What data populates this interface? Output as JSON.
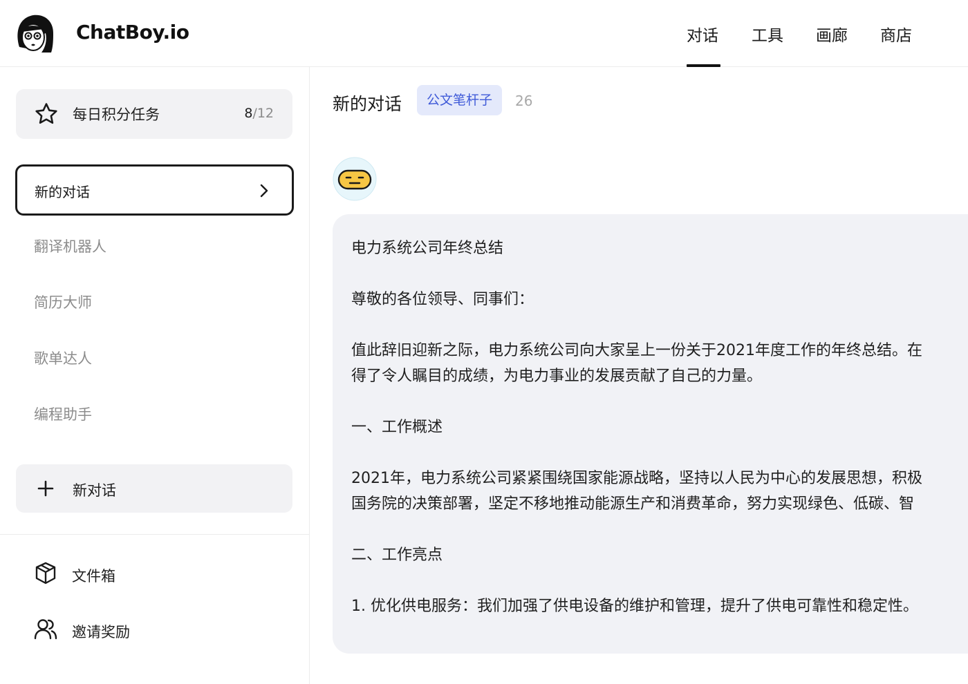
{
  "header": {
    "brand": "ChatBoy.io",
    "nav": [
      {
        "label": "对话",
        "active": true
      },
      {
        "label": "工具",
        "active": false
      },
      {
        "label": "画廊",
        "active": false
      },
      {
        "label": "商店",
        "active": false
      }
    ]
  },
  "sidebar": {
    "task": {
      "label": "每日积分任务",
      "done": "8",
      "total": "/12",
      "icon": "star-icon"
    },
    "active_conversation": {
      "label": "新的对话",
      "icon": "chevron-right-icon"
    },
    "conversations": [
      {
        "label": "翻译机器人"
      },
      {
        "label": "简历大师"
      },
      {
        "label": "歌单达人"
      },
      {
        "label": "编程助手"
      }
    ],
    "new_conversation": {
      "label": "新对话",
      "icon": "plus-icon"
    },
    "bottom": [
      {
        "label": "文件箱",
        "icon": "box-icon"
      },
      {
        "label": "邀请奖励",
        "icon": "users-icon"
      }
    ]
  },
  "main": {
    "title": "新的对话",
    "role_tag": "公文笔杆子",
    "count": "26",
    "message": {
      "lines": [
        "电力系统公司年终总结",
        "尊敬的各位领导、同事们：",
        "值此辞旧迎新之际，电力系统公司向大家呈上一份关于2021年度工作的年终总结。在",
        "得了令人瞩目的成绩，为电力事业的发展贡献了自己的力量。",
        "一、工作概述",
        "2021年，电力系统公司紧紧围绕国家能源战略，坚持以人民为中心的发展思想，积极",
        "国务院的决策部署，坚定不移地推动能源生产和消费革命，努力实现绿色、低碳、智",
        "二、工作亮点",
        "1. 优化供电服务：我们加强了供电设备的维护和管理，提升了供电可靠性和稳定性。"
      ]
    }
  },
  "colors": {
    "accent_text": "#3f5ad8",
    "tag_bg": "#e4e9fb",
    "card_bg": "#f2f2f4",
    "bubble_bg": "#f1f2f6"
  }
}
